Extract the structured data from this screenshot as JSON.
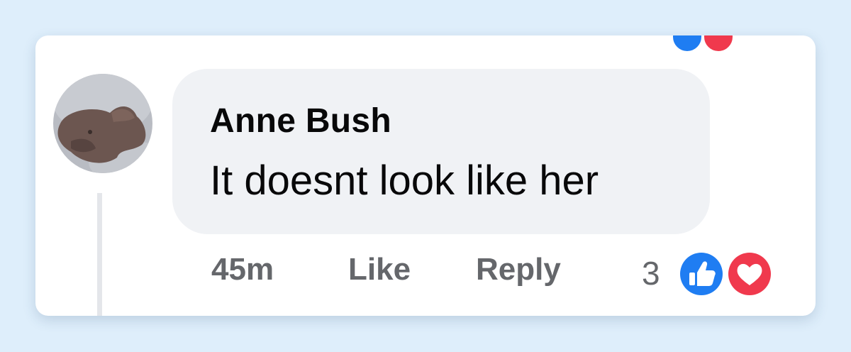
{
  "comment": {
    "author": "Anne Bush",
    "text": "It doesnt look like her",
    "time": "45m",
    "like_label": "Like",
    "reply_label": "Reply",
    "reaction_count": "3",
    "reactions": [
      "like-icon",
      "love-icon"
    ]
  },
  "colors": {
    "background": "#deeefb",
    "bubble": "#f0f2f5",
    "action_text": "#65676b",
    "like_blue": "#1f7df2",
    "love_red": "#f0394d"
  }
}
